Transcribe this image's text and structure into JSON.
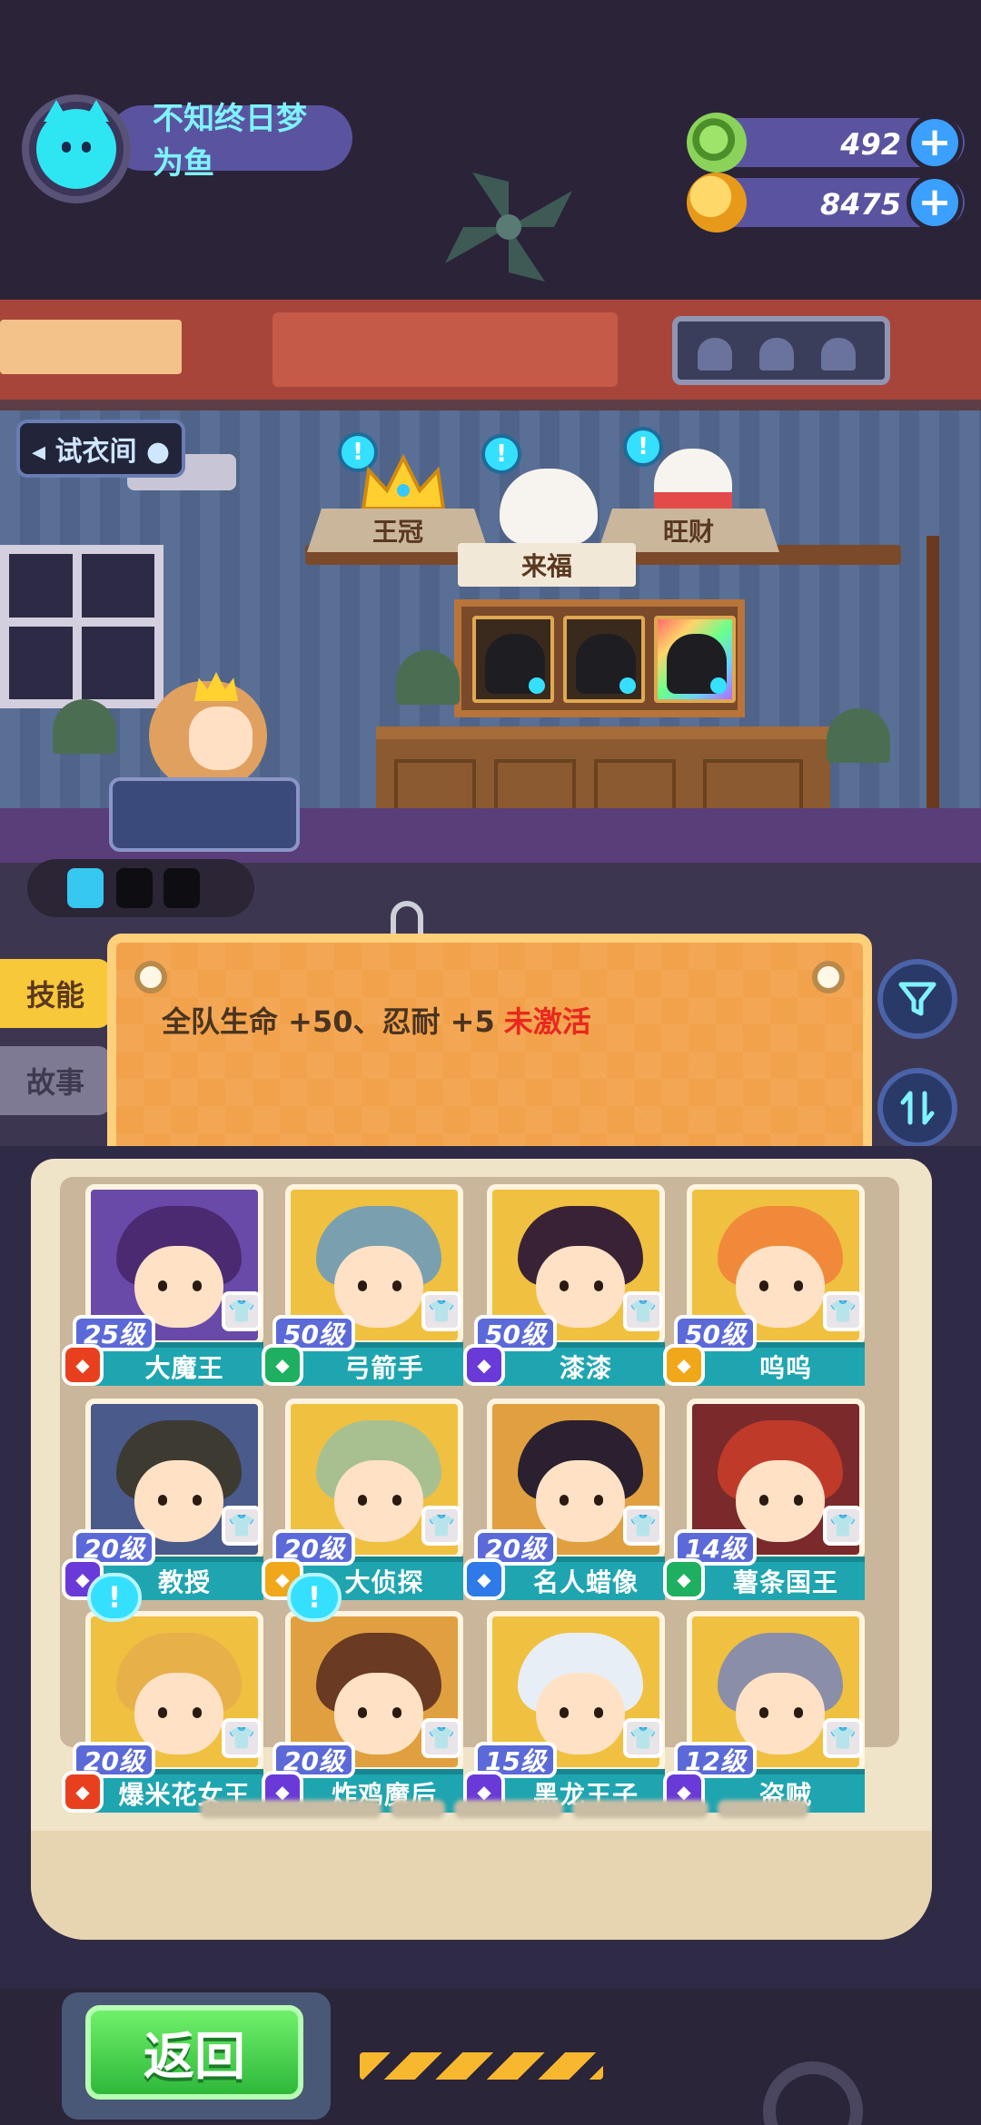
{
  "player": {
    "name": "不知终日梦为鱼",
    "avatar_icon": "cat-face-icon"
  },
  "currencies": [
    {
      "name": "green-donut",
      "icon": "donut-coin-icon",
      "value": "492"
    },
    {
      "name": "gold-planet",
      "icon": "planet-coin-icon",
      "value": "8475"
    }
  ],
  "room": {
    "sign": "◂ 试衣间 ●",
    "pets": [
      {
        "label": "王冠",
        "icon": "crown-icon",
        "bubble": "!"
      },
      {
        "label": "来福",
        "icon": "dog-icon",
        "bubble": "!"
      },
      {
        "label": "旺财",
        "icon": "cat-icon",
        "bubble": "!"
      }
    ],
    "selected_pet": "来福"
  },
  "tabs": {
    "skill": "技能",
    "story": "故事"
  },
  "board": {
    "bonus_text": "全队生命 +50、忍耐 +5",
    "status": "未激活"
  },
  "characters": [
    {
      "name": "大魔王",
      "level": "25级",
      "badge": "red",
      "hair": "#4b2a72",
      "bg": "#6a4aa8"
    },
    {
      "name": "弓箭手",
      "level": "50级",
      "badge": "green",
      "hair": "#7aa0b0",
      "bg": "#f0c040"
    },
    {
      "name": "漆漆",
      "level": "50级",
      "badge": "purple",
      "hair": "#3a2236",
      "bg": "#f0c040"
    },
    {
      "name": "呜呜",
      "level": "50级",
      "badge": "gold",
      "hair": "#f08a3a",
      "bg": "#f0c040"
    },
    {
      "name": "教授",
      "level": "20级",
      "badge": "purple",
      "hair": "#3d3a32",
      "bg": "#4a5a8a"
    },
    {
      "name": "大侦探",
      "level": "20级",
      "badge": "gold",
      "hair": "#a8c090",
      "bg": "#f0c040"
    },
    {
      "name": "名人蜡像",
      "level": "20级",
      "badge": "blue",
      "hair": "#2a2030",
      "bg": "#e0a040"
    },
    {
      "name": "薯条国王",
      "level": "14级",
      "badge": "green",
      "hair": "#c03a2a",
      "bg": "#7a2a2a"
    },
    {
      "name": "爆米花女王",
      "level": "20级",
      "badge": "red",
      "hair": "#e8b048",
      "bg": "#f0c040",
      "alert": "!"
    },
    {
      "name": "炸鸡魔后",
      "level": "20级",
      "badge": "purple",
      "hair": "#6a3a22",
      "bg": "#e0a040",
      "alert": "!"
    },
    {
      "name": "黑龙王子",
      "level": "15级",
      "badge": "purple",
      "hair": "#e8eef6",
      "bg": "#f0c040"
    },
    {
      "name": "盗贼",
      "level": "12级",
      "badge": "purple",
      "hair": "#8a8ea8",
      "bg": "#f0c040"
    }
  ],
  "bottom": {
    "back_label": "返回"
  },
  "colors": {
    "accent_cyan": "#35e0ff",
    "nameplate_teal": "#1fa5b0",
    "level_blue": "#5b6ad8",
    "status_red": "#e8281e",
    "back_green": "#2eb83a"
  }
}
